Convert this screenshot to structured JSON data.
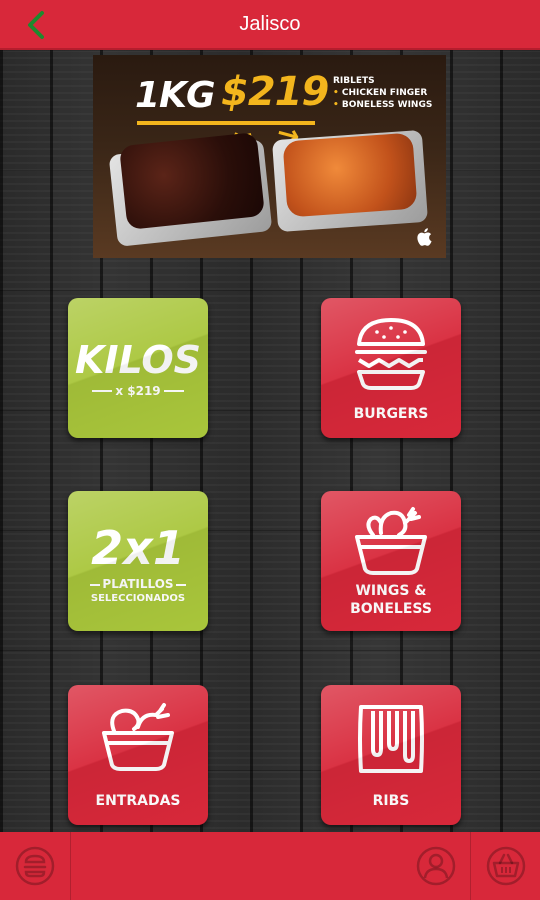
{
  "header": {
    "title": "Jalisco",
    "back_icon": "chevron-left-icon"
  },
  "banner": {
    "headline": "1KG",
    "price": "$219",
    "items": [
      "RIBLETS",
      "CHICKEN FINGER",
      "BONELESS WINGS"
    ],
    "brand_icon": "apple-icon"
  },
  "tiles": [
    {
      "id": "kilos",
      "big": "KILOS",
      "sub": "x $219",
      "color": "#a9c63b"
    },
    {
      "id": "burgers",
      "label": "BURGERS",
      "icon": "burger-icon",
      "color": "#d8283a"
    },
    {
      "id": "2x1",
      "big": "2x1",
      "sub1": "PLATILLOS",
      "sub2": "SELECCIONADOS",
      "color": "#a9c63b"
    },
    {
      "id": "wings",
      "label_line1": "WINGS &",
      "label_line2": "BONELESS",
      "icon": "wings-basket-icon",
      "color": "#d8283a"
    },
    {
      "id": "entradas",
      "label": "ENTRADAS",
      "icon": "chicken-basket-icon",
      "color": "#d8283a"
    },
    {
      "id": "ribs",
      "label": "RIBS",
      "icon": "ribs-icon",
      "color": "#d8283a"
    }
  ],
  "bottom_bar": {
    "menu_icon": "burger-menu-icon",
    "profile_icon": "user-icon",
    "cart_icon": "basket-icon"
  },
  "colors": {
    "brand_red": "#d8283a",
    "lime_green": "#a9c63b",
    "header_back": "#1e8a2e",
    "gold": "#f3b51d"
  }
}
